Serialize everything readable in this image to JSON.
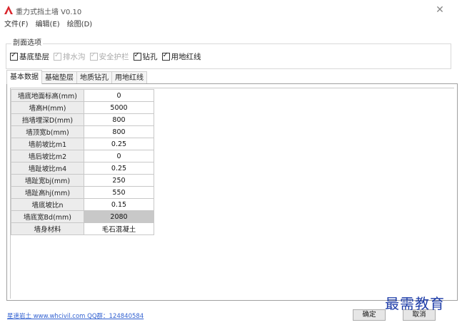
{
  "window": {
    "title": "重力式挡土墙 V0.10",
    "close_glyph": "✕"
  },
  "menu": [
    {
      "label": "文件(F)"
    },
    {
      "label": "编辑(E)"
    },
    {
      "label": "绘图(D)"
    }
  ],
  "section_options": {
    "title": "剖面选项",
    "checkboxes": [
      {
        "label": "基底垫层",
        "checked": true,
        "enabled": true
      },
      {
        "label": "排水沟",
        "checked": true,
        "enabled": false
      },
      {
        "label": "安全护栏",
        "checked": true,
        "enabled": false
      },
      {
        "label": "钻孔",
        "checked": true,
        "enabled": true
      },
      {
        "label": "用地红线",
        "checked": true,
        "enabled": true
      }
    ]
  },
  "tabs": [
    {
      "label": "基本数据",
      "active": true
    },
    {
      "label": "基础垫层",
      "active": false
    },
    {
      "label": "地质钻孔",
      "active": false
    },
    {
      "label": "用地红线",
      "active": false
    }
  ],
  "params": [
    {
      "label": "墙底地面标高(mm)",
      "value": "0"
    },
    {
      "label": "墙高H(mm)",
      "value": "5000"
    },
    {
      "label": "挡墙埋深D(mm)",
      "value": "800"
    },
    {
      "label": "墙顶宽b(mm)",
      "value": "800"
    },
    {
      "label": "墙前坡比m1",
      "value": "0.25"
    },
    {
      "label": "墙后坡比m2",
      "value": "0"
    },
    {
      "label": "墙趾坡比m4",
      "value": "0.25"
    },
    {
      "label": "墙趾宽bj(mm)",
      "value": "250"
    },
    {
      "label": "墙趾高hj(mm)",
      "value": "550"
    },
    {
      "label": "墙底坡比n",
      "value": "0.15"
    },
    {
      "label": "墙底宽Bd(mm)",
      "value": "2080",
      "computed": true
    },
    {
      "label": "墙身材料",
      "value": "毛石混凝土"
    }
  ],
  "footer": {
    "link_text": "星速岩土 www.whcivil.com QQ群：124840584",
    "ok_label": "确定",
    "cancel_label": "取消"
  },
  "watermark": "最需教育",
  "colors": {
    "link": "#2f5fd0",
    "app_icon": "#d9262c",
    "computed_cell": "#c8c8c8",
    "watermark": "#1e3da8"
  }
}
